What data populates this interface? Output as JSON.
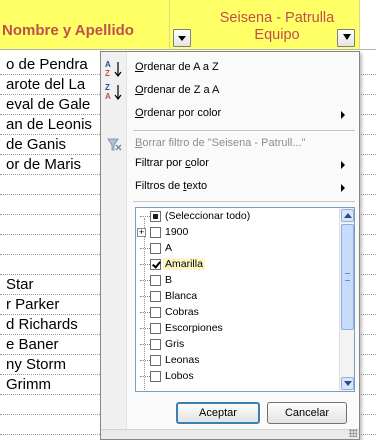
{
  "sheet": {
    "header_a": "Nombre y Apellido",
    "header_b_line1": "Seisena - Patrulla",
    "header_b_line2": "Equipo",
    "rows_top": [
      "o de Pendra",
      "arote del La",
      "eval de Gale",
      "an de Leonis",
      " de Ganis",
      "or de Maris"
    ],
    "rows_bottom": [
      " Star",
      "r Parker",
      "d Richards",
      "e Baner",
      "ny Storm",
      " Grimm"
    ]
  },
  "menu": {
    "sort_az": "Ordenar de A a Z",
    "sort_za": "Ordenar de Z a A",
    "sort_color": "Ordenar por color",
    "clear_filter": "Borrar filtro de \"Seisena - Patrull...\"",
    "filter_color": "Filtrar por color",
    "text_filters": "Filtros de texto",
    "icons": {
      "sort_az": "sort-ascending-icon",
      "sort_za": "sort-descending-icon",
      "clear": "clear-filter-icon"
    }
  },
  "list": {
    "items": [
      {
        "label": "(Seleccionar todo)",
        "state": "partial"
      },
      {
        "label": "1900",
        "state": "unchecked",
        "expandable": true
      },
      {
        "label": "A",
        "state": "unchecked"
      },
      {
        "label": "Amarilla",
        "state": "checked"
      },
      {
        "label": "B",
        "state": "unchecked"
      },
      {
        "label": "Blanca",
        "state": "unchecked"
      },
      {
        "label": "Cobras",
        "state": "unchecked"
      },
      {
        "label": "Escorpiones",
        "state": "unchecked"
      },
      {
        "label": "Gris",
        "state": "unchecked"
      },
      {
        "label": "Leonas",
        "state": "unchecked"
      },
      {
        "label": "Lobos",
        "state": "unchecked"
      }
    ]
  },
  "buttons": {
    "ok": "Aceptar",
    "cancel": "Cancelar"
  },
  "colors": {
    "header_fill": "#ffff66",
    "header_text": "#c0504d",
    "highlight": "#fdf7c5"
  }
}
